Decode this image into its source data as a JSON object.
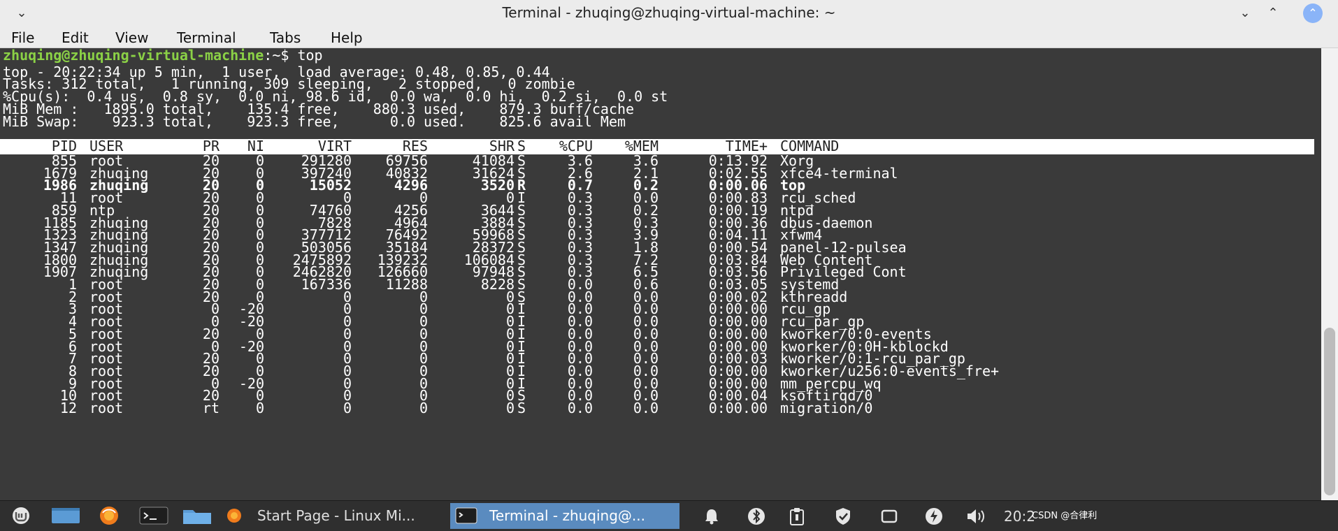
{
  "window": {
    "title": "Terminal - zhuqing@zhuqing-virtual-machine: ~",
    "menu_arrow": "⌄",
    "minimize": "⌄",
    "maximize": "⌃",
    "close": "⌃"
  },
  "menu": [
    "File",
    "Edit",
    "View",
    "Terminal",
    "Tabs",
    "Help"
  ],
  "terminal": {
    "prompt_user": "zhuqing@zhuqing-virtual-machine",
    "prompt_path": ":~$ ",
    "command": "top",
    "summary": [
      "top - 20:22:34 up 5 min,  1 user,  load average: 0.48, 0.85, 0.44",
      "Tasks: 312 total,   1 running, 309 sleeping,   2 stopped,   0 zombie",
      "%Cpu(s):  0.4 us,  0.8 sy,  0.0 ni, 98.6 id,  0.0 wa,  0.0 hi,  0.2 si,  0.0 st",
      "MiB Mem :   1895.0 total,    135.4 free,    880.3 used,    879.3 buff/cache",
      "MiB Swap:    923.3 total,    923.3 free,      0.0 used.    825.6 avail Mem"
    ],
    "columns": [
      "PID",
      "USER",
      "PR",
      "NI",
      "VIRT",
      "RES",
      "SHR",
      "S",
      "%CPU",
      "%MEM",
      "TIME+",
      "COMMAND"
    ],
    "processes": [
      [
        "855",
        "root",
        "20",
        "0",
        "291280",
        "69756",
        "41084",
        "S",
        "3.6",
        "3.6",
        "0:13.92",
        "Xorg"
      ],
      [
        "1679",
        "zhuqing",
        "20",
        "0",
        "397240",
        "40832",
        "31624",
        "S",
        "2.6",
        "2.1",
        "0:02.55",
        "xfce4-terminal"
      ],
      [
        "1986",
        "zhuqing",
        "20",
        "0",
        "15052",
        "4296",
        "3520",
        "R",
        "0.7",
        "0.2",
        "0:00.06",
        "top"
      ],
      [
        "11",
        "root",
        "20",
        "0",
        "0",
        "0",
        "0",
        "I",
        "0.3",
        "0.0",
        "0:00.83",
        "rcu_sched"
      ],
      [
        "859",
        "ntp",
        "20",
        "0",
        "74760",
        "4256",
        "3644",
        "S",
        "0.3",
        "0.2",
        "0:00.19",
        "ntpd"
      ],
      [
        "1185",
        "zhuqing",
        "20",
        "0",
        "7828",
        "4964",
        "3884",
        "S",
        "0.3",
        "0.3",
        "0:00.36",
        "dbus-daemon"
      ],
      [
        "1323",
        "zhuqing",
        "20",
        "0",
        "377712",
        "76492",
        "59968",
        "S",
        "0.3",
        "3.9",
        "0:04.11",
        "xfwm4"
      ],
      [
        "1347",
        "zhuqing",
        "20",
        "0",
        "503056",
        "35184",
        "28372",
        "S",
        "0.3",
        "1.8",
        "0:00.54",
        "panel-12-pulsea"
      ],
      [
        "1800",
        "zhuqing",
        "20",
        "0",
        "2475892",
        "139232",
        "106084",
        "S",
        "0.3",
        "7.2",
        "0:03.84",
        "Web Content"
      ],
      [
        "1907",
        "zhuqing",
        "20",
        "0",
        "2462820",
        "126660",
        "97948",
        "S",
        "0.3",
        "6.5",
        "0:03.56",
        "Privileged Cont"
      ],
      [
        "1",
        "root",
        "20",
        "0",
        "167336",
        "11288",
        "8228",
        "S",
        "0.0",
        "0.6",
        "0:03.05",
        "systemd"
      ],
      [
        "2",
        "root",
        "20",
        "0",
        "0",
        "0",
        "0",
        "S",
        "0.0",
        "0.0",
        "0:00.02",
        "kthreadd"
      ],
      [
        "3",
        "root",
        "0",
        "-20",
        "0",
        "0",
        "0",
        "I",
        "0.0",
        "0.0",
        "0:00.00",
        "rcu_gp"
      ],
      [
        "4",
        "root",
        "0",
        "-20",
        "0",
        "0",
        "0",
        "I",
        "0.0",
        "0.0",
        "0:00.00",
        "rcu_par_gp"
      ],
      [
        "5",
        "root",
        "20",
        "0",
        "0",
        "0",
        "0",
        "I",
        "0.0",
        "0.0",
        "0:00.00",
        "kworker/0:0-events"
      ],
      [
        "6",
        "root",
        "0",
        "-20",
        "0",
        "0",
        "0",
        "I",
        "0.0",
        "0.0",
        "0:00.00",
        "kworker/0:0H-kblockd"
      ],
      [
        "7",
        "root",
        "20",
        "0",
        "0",
        "0",
        "0",
        "I",
        "0.0",
        "0.0",
        "0:00.03",
        "kworker/0:1-rcu_par_gp"
      ],
      [
        "8",
        "root",
        "20",
        "0",
        "0",
        "0",
        "0",
        "I",
        "0.0",
        "0.0",
        "0:00.00",
        "kworker/u256:0-events_fre+"
      ],
      [
        "9",
        "root",
        "0",
        "-20",
        "0",
        "0",
        "0",
        "I",
        "0.0",
        "0.0",
        "0:00.00",
        "mm_percpu_wq"
      ],
      [
        "10",
        "root",
        "20",
        "0",
        "0",
        "0",
        "0",
        "S",
        "0.0",
        "0.0",
        "0:00.04",
        "ksoftirqd/0"
      ],
      [
        "12",
        "root",
        "rt",
        "0",
        "0",
        "0",
        "0",
        "S",
        "0.0",
        "0.0",
        "0:00.00",
        "migration/0"
      ]
    ],
    "bold_row_index": 2
  },
  "taskbar": {
    "windows": [
      {
        "label": "Start Page - Linux Mi...",
        "active": false
      },
      {
        "label": "Terminal - zhuqing@...",
        "active": true
      }
    ],
    "clock": "20:2",
    "watermark": "CSDN @合律利"
  },
  "colors": {
    "prompt_green": "#8bd146",
    "terminal_bg": "#3a3a3a",
    "active_task": "#5a8bbf"
  }
}
